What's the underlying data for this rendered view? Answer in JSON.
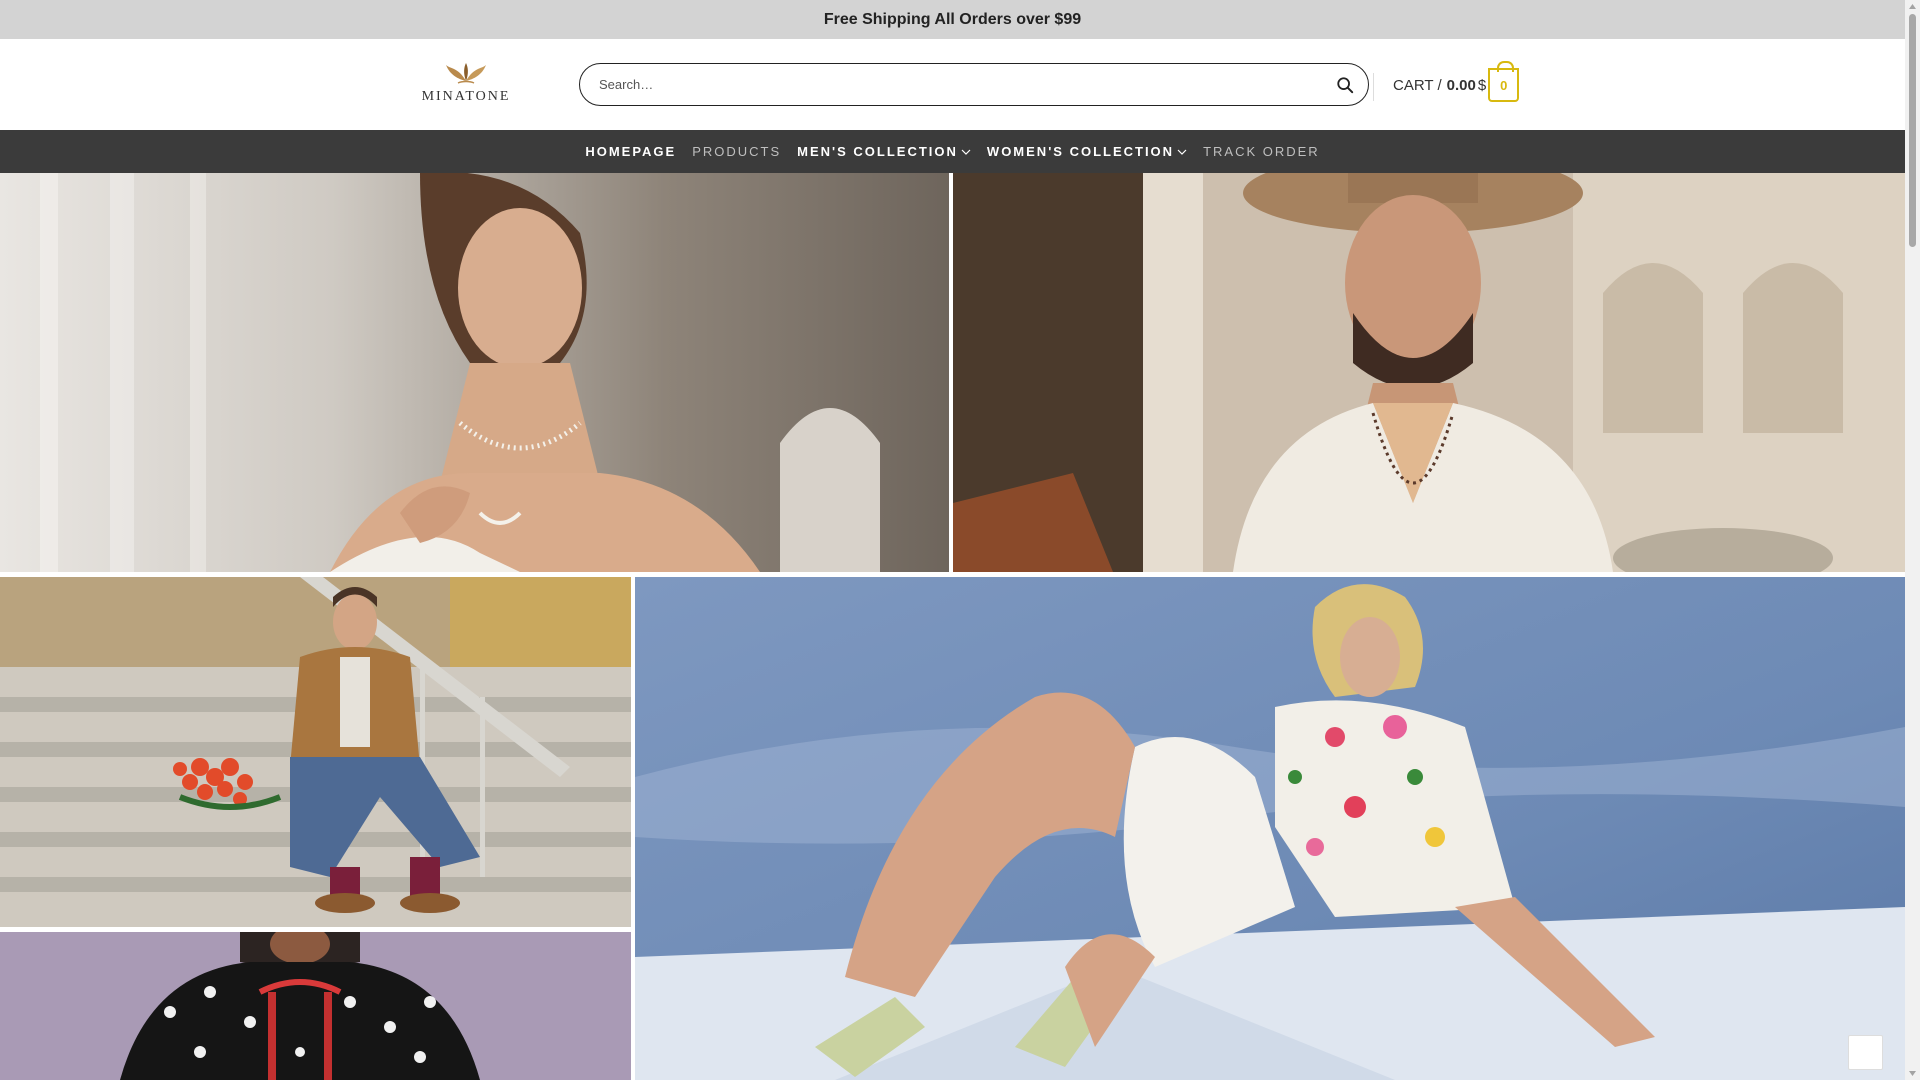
{
  "announcement": {
    "text": "Free Shipping All Orders over $99"
  },
  "header": {
    "logo_text": "MINATONE",
    "search": {
      "placeholder": "Search…",
      "value": ""
    },
    "cart": {
      "label": "CART /",
      "amount": "0.00",
      "currency": "$",
      "count": "0"
    }
  },
  "nav": {
    "items": [
      {
        "label": "HOMEPAGE",
        "active": true
      },
      {
        "label": "PRODUCTS",
        "active": false
      },
      {
        "label": "MEN'S COLLECTION",
        "active": true,
        "dropdown": true
      },
      {
        "label": "WOMEN'S COLLECTION",
        "active": true,
        "dropdown": true
      },
      {
        "label": "TRACK ORDER",
        "active": false
      }
    ]
  },
  "gallery": {
    "tiles": [
      {
        "name": "bride-pearl-necklace-photo"
      },
      {
        "name": "man-straw-hat-photo"
      },
      {
        "name": "man-on-stairs-with-roses-photo"
      },
      {
        "name": "woman-floral-suit-photo"
      },
      {
        "name": "woman-polka-dot-photo"
      }
    ]
  },
  "colors": {
    "announcement_bg": "#d3d3d3",
    "nav_bg": "#3b3b3b",
    "accent": "#d8b90f"
  }
}
